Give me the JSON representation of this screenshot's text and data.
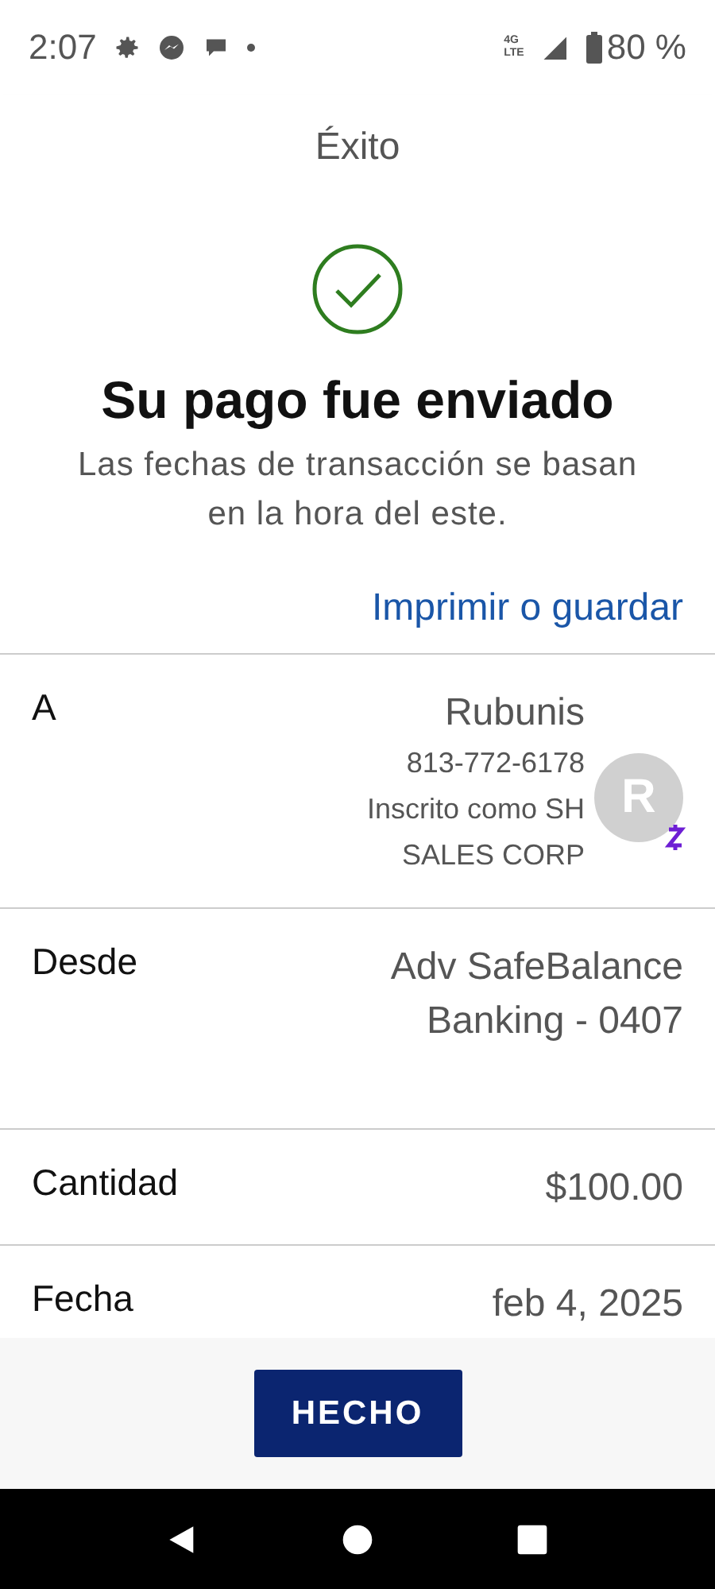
{
  "status_bar": {
    "time": "2:07",
    "network": [
      "4G",
      "LTE"
    ],
    "battery": "80 %"
  },
  "header": {
    "title": "Éxito"
  },
  "result": {
    "heading": "Su pago fue enviado",
    "note": "Las fechas de transacción se basan en la hora del este.",
    "link": "Imprimir o guardar"
  },
  "details": [
    {
      "kind": "recipient",
      "label": "A",
      "lines": [
        "Rubunis",
        "813-772-6178",
        "Inscrito como SH",
        "SALES CORP"
      ],
      "avatar_letter": "R"
    },
    {
      "kind": "plain",
      "label": "Desde",
      "lines": [
        "Adv SafeBalance",
        "Banking - 0407"
      ]
    },
    {
      "kind": "plain",
      "label": "Cantidad",
      "lines": [
        "$100.00"
      ]
    },
    {
      "kind": "plain",
      "label": "Fecha",
      "lines": [
        "feb 4, 2025"
      ]
    }
  ],
  "footer": {
    "button": "HECHO"
  }
}
